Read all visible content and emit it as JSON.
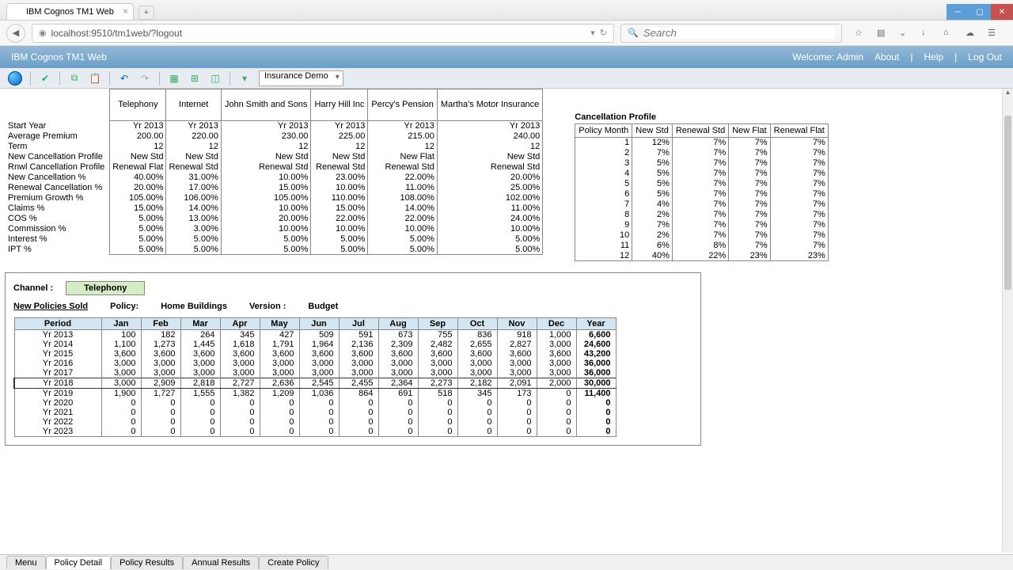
{
  "browser": {
    "tab_title": "IBM Cognos TM1 Web",
    "url": "localhost:9510/tm1web/?logout",
    "search_placeholder": "Search"
  },
  "header": {
    "app_title": "IBM Cognos TM1 Web",
    "welcome": "Welcome: Admin",
    "about": "About",
    "help": "Help",
    "logout": "Log Out"
  },
  "toolbar": {
    "select_value": "Insurance Demo"
  },
  "channels_table": {
    "cols": [
      "Telephony",
      "Internet",
      "John Smith and Sons",
      "Harry Hill Inc",
      "Percy's Pension",
      "Martha's Motor Insurance"
    ],
    "rows": [
      {
        "label": "Start Year",
        "v": [
          "Yr 2013",
          "Yr 2013",
          "Yr 2013",
          "Yr 2013",
          "Yr 2013",
          "Yr 2013"
        ]
      },
      {
        "label": "Average Premium",
        "v": [
          "200.00",
          "220.00",
          "230.00",
          "225.00",
          "215.00",
          "240.00"
        ]
      },
      {
        "label": "Term",
        "v": [
          "12",
          "12",
          "12",
          "12",
          "12",
          "12"
        ]
      },
      {
        "label": "New Cancellation Profile",
        "v": [
          "New Std",
          "New Std",
          "New Std",
          "New Std",
          "New Flat",
          "New Std"
        ]
      },
      {
        "label": "Rnwl Cancellation Profile",
        "v": [
          "Renewal Flat",
          "Renewal Std",
          "Renewal Std",
          "Renewal Std",
          "Renewal Std",
          "Renewal Std"
        ]
      },
      {
        "label": "New Cancellation %",
        "v": [
          "40.00%",
          "31.00%",
          "10.00%",
          "23.00%",
          "22.00%",
          "20.00%"
        ]
      },
      {
        "label": "Renewal Cancellation %",
        "v": [
          "20.00%",
          "17.00%",
          "15.00%",
          "10.00%",
          "11.00%",
          "25.00%"
        ]
      },
      {
        "label": "Premium Growth %",
        "v": [
          "105.00%",
          "106.00%",
          "105.00%",
          "110.00%",
          "108.00%",
          "102.00%"
        ]
      },
      {
        "label": "Claims %",
        "v": [
          "15.00%",
          "14.00%",
          "10.00%",
          "15.00%",
          "14.00%",
          "11.00%"
        ]
      },
      {
        "label": "COS %",
        "v": [
          "5.00%",
          "13.00%",
          "20.00%",
          "22.00%",
          "22.00%",
          "24.00%"
        ]
      },
      {
        "label": "Commission %",
        "v": [
          "5.00%",
          "3.00%",
          "10.00%",
          "10.00%",
          "10.00%",
          "10.00%"
        ]
      },
      {
        "label": "Interest %",
        "v": [
          "5.00%",
          "5.00%",
          "5.00%",
          "5.00%",
          "5.00%",
          "5.00%"
        ]
      },
      {
        "label": "IPT %",
        "v": [
          "5.00%",
          "5.00%",
          "5.00%",
          "5.00%",
          "5.00%",
          "5.00%"
        ]
      }
    ]
  },
  "cancel_profile": {
    "title": "Cancellation Profile",
    "cols": [
      "Policy Month",
      "New Std",
      "Renewal Std",
      "New Flat",
      "Renewal Flat"
    ],
    "rows": [
      {
        "v": [
          "1",
          "12%",
          "7%",
          "7%",
          "7%"
        ]
      },
      {
        "v": [
          "2",
          "7%",
          "7%",
          "7%",
          "7%"
        ]
      },
      {
        "v": [
          "3",
          "5%",
          "7%",
          "7%",
          "7%"
        ]
      },
      {
        "v": [
          "4",
          "5%",
          "7%",
          "7%",
          "7%"
        ]
      },
      {
        "v": [
          "5",
          "5%",
          "7%",
          "7%",
          "7%"
        ]
      },
      {
        "v": [
          "6",
          "5%",
          "7%",
          "7%",
          "7%"
        ]
      },
      {
        "v": [
          "7",
          "4%",
          "7%",
          "7%",
          "7%"
        ]
      },
      {
        "v": [
          "8",
          "2%",
          "7%",
          "7%",
          "7%"
        ]
      },
      {
        "v": [
          "9",
          "7%",
          "7%",
          "7%",
          "7%"
        ]
      },
      {
        "v": [
          "10",
          "2%",
          "7%",
          "7%",
          "7%"
        ]
      },
      {
        "v": [
          "11",
          "6%",
          "8%",
          "7%",
          "7%"
        ]
      },
      {
        "v": [
          "12",
          "40%",
          "22%",
          "23%",
          "23%"
        ]
      }
    ]
  },
  "lower": {
    "channel_label": "Channel :",
    "channel_value": "Telephony",
    "policies_sold": "New Policies Sold",
    "policy_label": "Policy:",
    "policy_value": "Home Buildings",
    "version_label": "Version :",
    "version_value": "Budget",
    "cols": [
      "Period",
      "Jan",
      "Feb",
      "Mar",
      "Apr",
      "May",
      "Jun",
      "Jul",
      "Aug",
      "Sep",
      "Oct",
      "Nov",
      "Dec",
      "Year"
    ],
    "rows": [
      {
        "p": "Yr 2013",
        "v": [
          "100",
          "182",
          "264",
          "345",
          "427",
          "509",
          "591",
          "673",
          "755",
          "836",
          "918",
          "1,000"
        ],
        "y": "6,600"
      },
      {
        "p": "Yr 2014",
        "v": [
          "1,100",
          "1,273",
          "1,445",
          "1,618",
          "1,791",
          "1,964",
          "2,136",
          "2,309",
          "2,482",
          "2,655",
          "2,827",
          "3,000"
        ],
        "y": "24,600"
      },
      {
        "p": "Yr 2015",
        "v": [
          "3,600",
          "3,600",
          "3,600",
          "3,600",
          "3,600",
          "3,600",
          "3,600",
          "3,600",
          "3,600",
          "3,600",
          "3,600",
          "3,600"
        ],
        "y": "43,200"
      },
      {
        "p": "Yr 2016",
        "v": [
          "3,000",
          "3,000",
          "3,000",
          "3,000",
          "3,000",
          "3,000",
          "3,000",
          "3,000",
          "3,000",
          "3,000",
          "3,000",
          "3,000"
        ],
        "y": "36,000"
      },
      {
        "p": "Yr 2017",
        "v": [
          "3,000",
          "3,000",
          "3,000",
          "3,000",
          "3,000",
          "3,000",
          "3,000",
          "3,000",
          "3,000",
          "3,000",
          "3,000",
          "3,000"
        ],
        "y": "36,000"
      },
      {
        "p": "Yr 2018",
        "v": [
          "3,000",
          "2,909",
          "2,818",
          "2,727",
          "2,636",
          "2,545",
          "2,455",
          "2,364",
          "2,273",
          "2,182",
          "2,091",
          "2,000"
        ],
        "y": "30,000",
        "hl": true
      },
      {
        "p": "Yr 2019",
        "v": [
          "1,900",
          "1,727",
          "1,555",
          "1,382",
          "1,209",
          "1,036",
          "864",
          "691",
          "518",
          "345",
          "173",
          "0"
        ],
        "y": "11,400"
      },
      {
        "p": "Yr 2020",
        "v": [
          "0",
          "0",
          "0",
          "0",
          "0",
          "0",
          "0",
          "0",
          "0",
          "0",
          "0",
          "0"
        ],
        "y": "0"
      },
      {
        "p": "Yr 2021",
        "v": [
          "0",
          "0",
          "0",
          "0",
          "0",
          "0",
          "0",
          "0",
          "0",
          "0",
          "0",
          "0"
        ],
        "y": "0"
      },
      {
        "p": "Yr 2022",
        "v": [
          "0",
          "0",
          "0",
          "0",
          "0",
          "0",
          "0",
          "0",
          "0",
          "0",
          "0",
          "0"
        ],
        "y": "0"
      },
      {
        "p": "Yr 2023",
        "v": [
          "0",
          "0",
          "0",
          "0",
          "0",
          "0",
          "0",
          "0",
          "0",
          "0",
          "0",
          "0"
        ],
        "y": "0"
      }
    ]
  },
  "footer_tabs": [
    "Menu",
    "Policy Detail",
    "Policy Results",
    "Annual Results",
    "Create Policy"
  ],
  "footer_active": 1
}
